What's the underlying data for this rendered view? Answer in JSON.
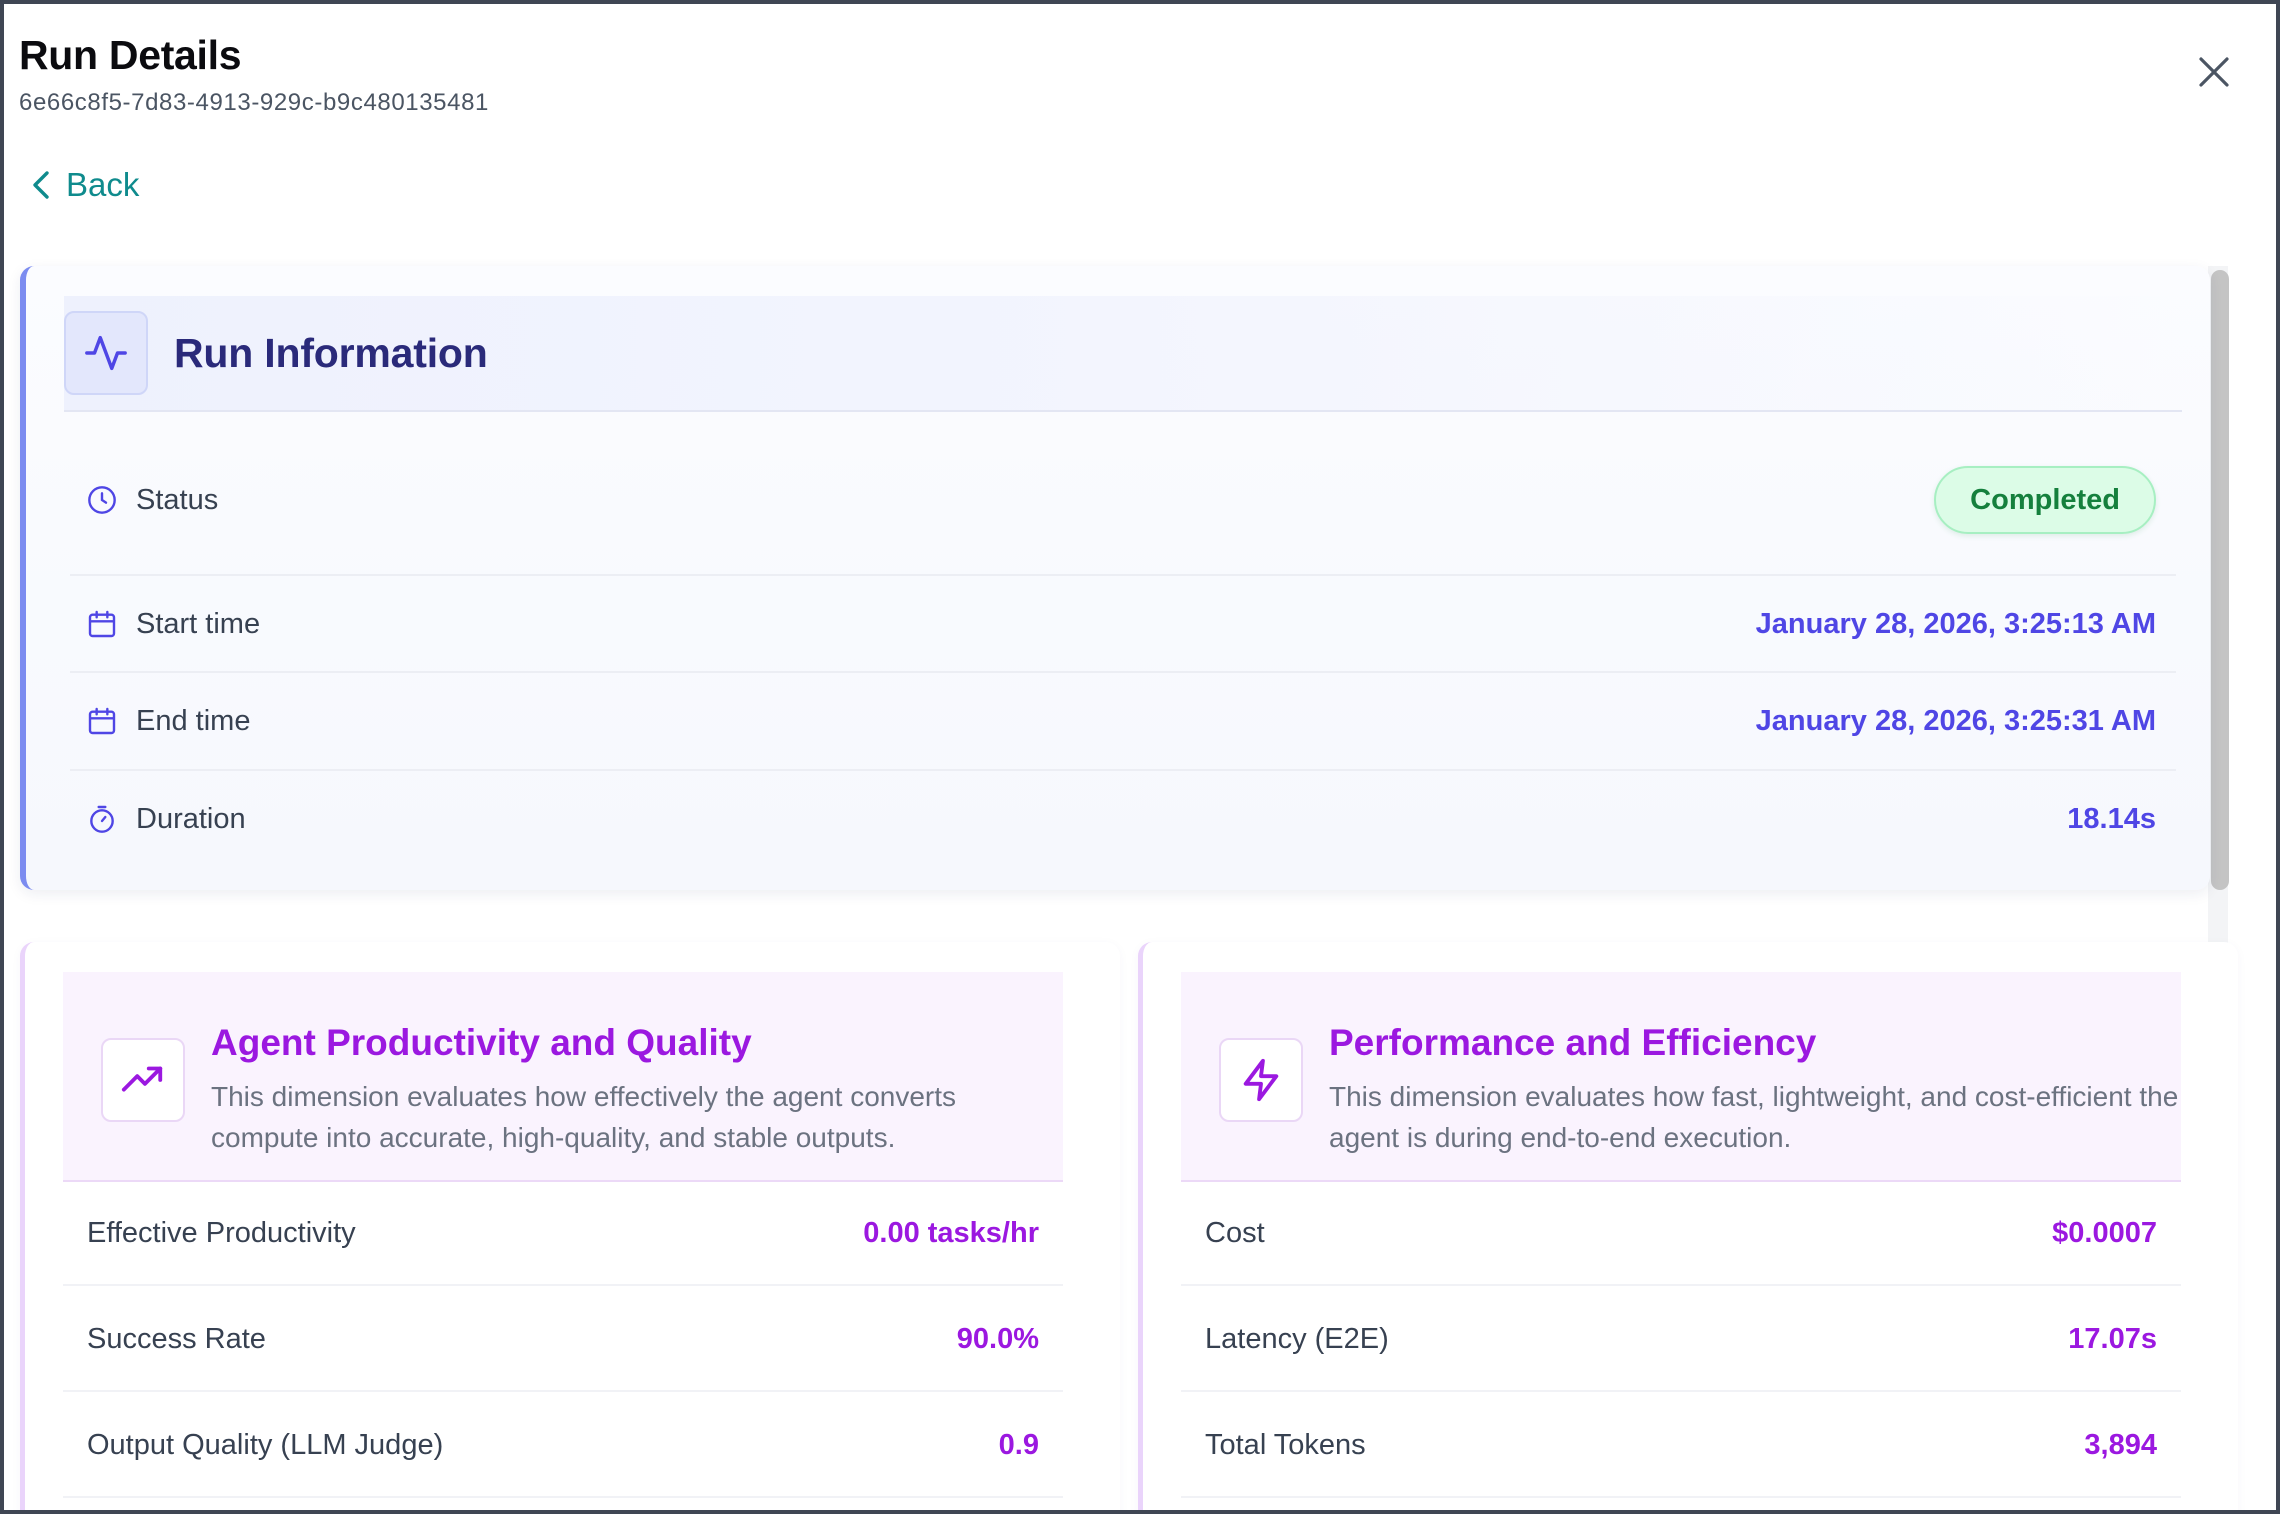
{
  "modal": {
    "title": "Run Details",
    "run_id": "6e66c8f5-7d83-4913-929c-b9c480135481",
    "close_icon": "close-icon",
    "back_label": "Back",
    "back_icon": "chevron-left-icon"
  },
  "run_info": {
    "title": "Run Information",
    "icon": "activity-icon",
    "rows": [
      {
        "label": "Status",
        "icon": "clock-icon",
        "value": "Completed"
      },
      {
        "label": "Start time",
        "icon": "calendar-icon",
        "value": "January 28, 2026, 3:25:13 AM"
      },
      {
        "label": "End time",
        "icon": "calendar-icon",
        "value": "January 28, 2026, 3:25:31 AM"
      },
      {
        "label": "Duration",
        "icon": "timer-icon",
        "value": "18.14s"
      }
    ]
  },
  "dimensions": [
    {
      "title": "Agent Productivity and Quality",
      "icon": "trending-up-icon",
      "description": "This dimension evaluates how effectively the agent converts compute into accurate, high-quality, and stable outputs.",
      "metrics": [
        {
          "label": "Effective Productivity",
          "value": "0.00 tasks/hr"
        },
        {
          "label": "Success Rate",
          "value": "90.0%"
        },
        {
          "label": "Output Quality (LLM Judge)",
          "value": "0.9"
        }
      ]
    },
    {
      "title": "Performance and Efficiency",
      "icon": "lightning-icon",
      "description": "This dimension evaluates how fast, lightweight, and cost-efficient the agent is during end-to-end execution.",
      "metrics": [
        {
          "label": "Cost",
          "value": "$0.0007"
        },
        {
          "label": "Latency (E2E)",
          "value": "17.07s"
        },
        {
          "label": "Total Tokens",
          "value": "3,894"
        }
      ]
    }
  ],
  "colors": {
    "accent_teal": "#0f8b8d",
    "indigo": "#4f46e5",
    "purple": "#9b18e0",
    "status_green": "#15803d"
  }
}
